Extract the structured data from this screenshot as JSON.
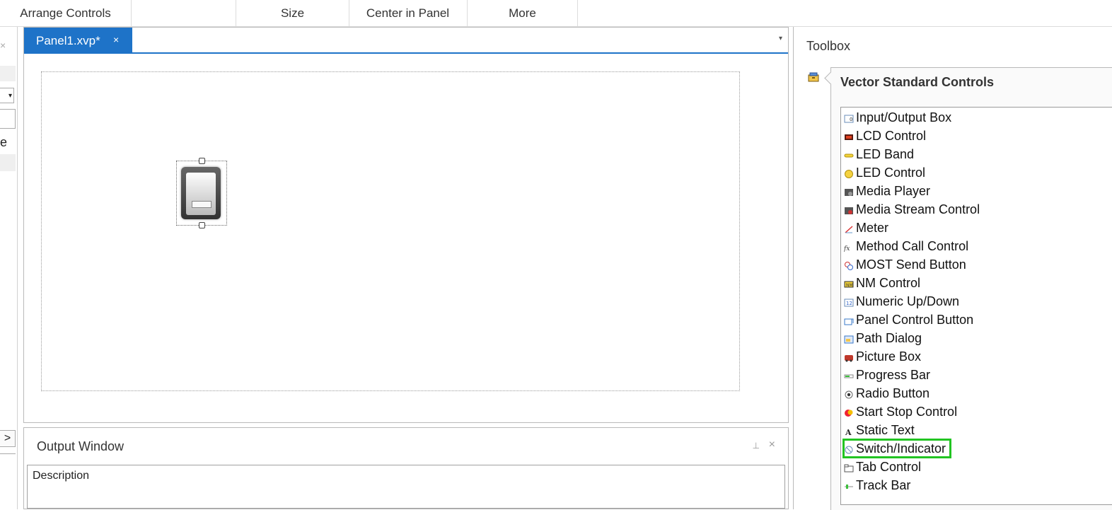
{
  "ribbon": {
    "groups": [
      "Arrange Controls",
      "Size",
      "Center in Panel",
      "More"
    ]
  },
  "left_pane": {
    "close_glyph": "×",
    "combo_glyph": "▾",
    "partial_letter": "e",
    "expand_glyph": ">"
  },
  "document": {
    "tab_label": "Panel1.xvp*",
    "tab_close": "×",
    "tab_menu_glyph": "▾"
  },
  "output": {
    "title": "Output Window",
    "pin_glyph": "⊥",
    "close_glyph": "×",
    "column_description": "Description"
  },
  "toolbox": {
    "title": "Toolbox",
    "group_name": "Vector Standard Controls",
    "items": [
      {
        "label": "Input/Output Box",
        "icon": "io-box-icon"
      },
      {
        "label": "LCD Control",
        "icon": "lcd-icon"
      },
      {
        "label": "LED Band",
        "icon": "led-band-icon"
      },
      {
        "label": "LED Control",
        "icon": "led-icon"
      },
      {
        "label": "Media Player",
        "icon": "media-player-icon"
      },
      {
        "label": "Media Stream Control",
        "icon": "media-stream-icon"
      },
      {
        "label": "Meter",
        "icon": "meter-icon"
      },
      {
        "label": "Method Call Control",
        "icon": "method-call-icon"
      },
      {
        "label": "MOST Send Button",
        "icon": "most-send-icon"
      },
      {
        "label": "NM Control",
        "icon": "nm-icon"
      },
      {
        "label": "Numeric Up/Down",
        "icon": "numeric-updown-icon"
      },
      {
        "label": "Panel Control Button",
        "icon": "panel-control-icon"
      },
      {
        "label": "Path Dialog",
        "icon": "path-dialog-icon"
      },
      {
        "label": "Picture Box",
        "icon": "picture-box-icon"
      },
      {
        "label": "Progress Bar",
        "icon": "progress-bar-icon"
      },
      {
        "label": "Radio Button",
        "icon": "radio-button-icon"
      },
      {
        "label": "Start Stop Control",
        "icon": "start-stop-icon"
      },
      {
        "label": "Static Text",
        "icon": "static-text-icon"
      },
      {
        "label": "Switch/Indicator",
        "icon": "switch-indicator-icon",
        "selected": true
      },
      {
        "label": "Tab Control",
        "icon": "tab-control-icon"
      },
      {
        "label": "Track Bar",
        "icon": "track-bar-icon"
      }
    ]
  },
  "colors": {
    "accent": "#1e73c8",
    "selection_outline": "#22c422"
  }
}
